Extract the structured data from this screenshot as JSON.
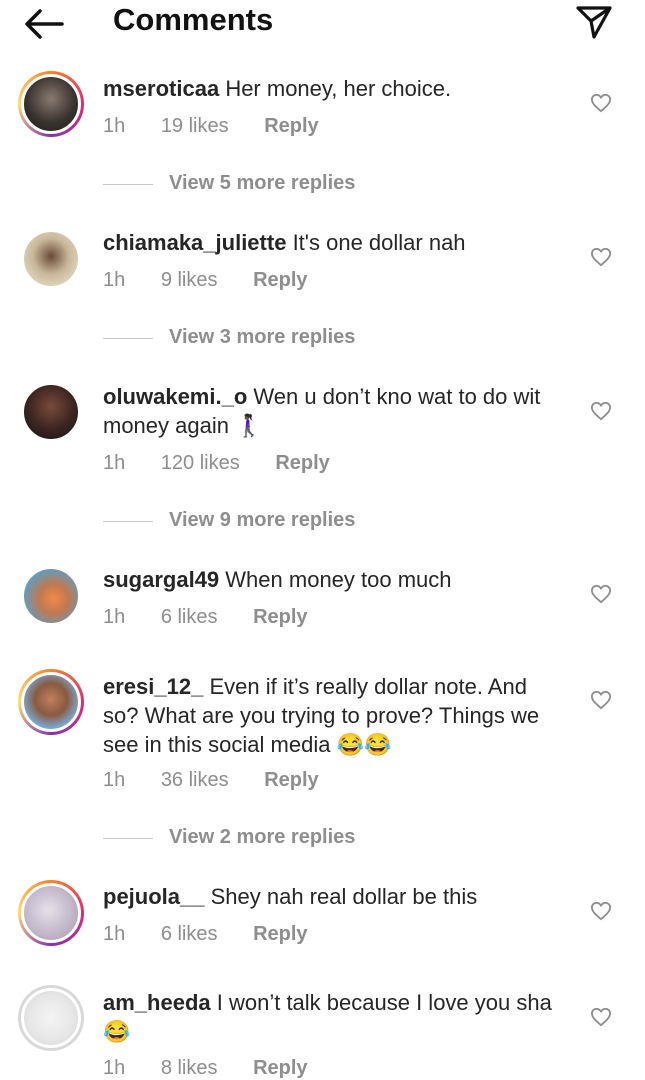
{
  "header": {
    "title": "Comments",
    "back_icon": "arrow-left-icon",
    "send_icon": "paper-plane-icon"
  },
  "colors": {
    "text": "#262626",
    "muted": "#8e8e8e",
    "ring_start": "#f58529",
    "ring_end": "#dd2a7b"
  },
  "comments": [
    {
      "username": "mseroticaa",
      "text": "Her money, her choice.",
      "time": "1h",
      "likes": "19 likes",
      "reply": "Reply",
      "more_replies": "View 5 more replies"
    },
    {
      "username": "chiamaka_juliette",
      "text": "It's one dollar nah",
      "time": "1h",
      "likes": "9 likes",
      "reply": "Reply",
      "more_replies": "View 3 more replies"
    },
    {
      "username": "oluwakemi._o",
      "text": "Wen u don’t kno wat to do wit money again 🚶🏿‍♀️",
      "time": "1h",
      "likes": "120 likes",
      "reply": "Reply",
      "more_replies": "View 9 more replies"
    },
    {
      "username": "sugargal49",
      "text": "When money too much",
      "time": "1h",
      "likes": "6 likes",
      "reply": "Reply"
    },
    {
      "username": "eresi_12_",
      "text": "Even if it’s really dollar note. And so? What are you trying to prove? Things we see in this social media 😂😂",
      "time": "1h",
      "likes": "36 likes",
      "reply": "Reply",
      "more_replies": "View 2 more replies"
    },
    {
      "username": "pejuola__",
      "text": "Shey nah real dollar be this",
      "time": "1h",
      "likes": "6 likes",
      "reply": "Reply"
    },
    {
      "username": "am_heeda",
      "text": "I won’t talk because I love you sha😂",
      "time": "1h",
      "likes": "8 likes",
      "reply": "Reply"
    }
  ]
}
